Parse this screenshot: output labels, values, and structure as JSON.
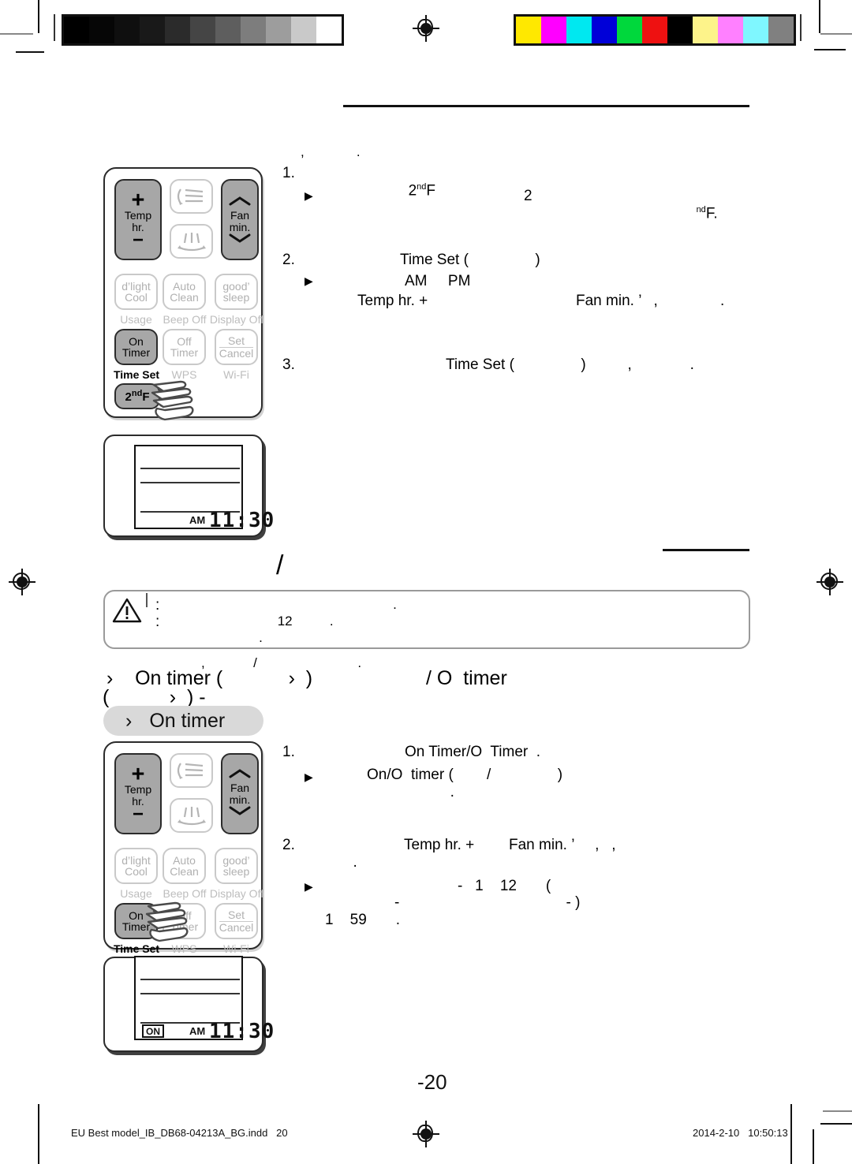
{
  "page": {
    "number": "-20",
    "footer_file": "EU Best model_IB_DB68-04213A_BG.indd   20",
    "footer_timestamp": "2014-2-10   10:50:13"
  },
  "printmarks": {
    "grayscale_steps": [
      "#000000",
      "#070707",
      "#101010",
      "#1a1a1a",
      "#2b2b2b",
      "#454545",
      "#5e5e5e",
      "#7d7d7d",
      "#9d9d9d",
      "#c6c6c6",
      "#ffffff"
    ],
    "color_steps": [
      "#ffe800",
      "#ff00ff",
      "#00e8f0",
      "#0000d8",
      "#00d83c",
      "#ee1111",
      "#000000",
      "#fff municipal",
      "#ff80ff",
      "#7ff7ff",
      "#808080"
    ],
    "color_steps_fixed": [
      "#ffe800",
      "#ff00ff",
      "#00e8f0",
      "#0000d8",
      "#00d83c",
      "#ee1111",
      "#000000",
      "#fdf38a",
      "#ff80ff",
      "#7ff7ff",
      "#808080"
    ]
  },
  "remote": {
    "temp_plus": "+",
    "temp_label_1": "Temp",
    "temp_label_2": "hr.",
    "temp_minus": "−",
    "fan_up": "⌃",
    "fan_label_1": "Fan",
    "fan_label_2": "min.",
    "fan_down": "⌄",
    "dlight_1": "d’light",
    "dlight_2": "Cool",
    "usage": "Usage",
    "auto_1": "Auto",
    "auto_2": "Clean",
    "beep_off": "Beep Off",
    "good_1": "good’",
    "good_2": "sleep",
    "display_off": "Display Off",
    "on_timer_1": "On",
    "on_timer_2": "Timer",
    "time_set": "Time Set",
    "off_timer_1": "Off",
    "off_timer_2": "Timer",
    "wps": "WPS",
    "set": "Set",
    "cancel": "Cancel",
    "wifi": "Wi-Fi",
    "secondf": "2",
    "secondf_sup": "nd",
    "secondf_tail": "F"
  },
  "lcd_top": {
    "ampm": "AM",
    "time": "11:30"
  },
  "lcd_bottom": {
    "on_badge": "ON",
    "ampm": "AM",
    "time": "11:30"
  },
  "section_top": {
    "intro_fragment": ",              .",
    "step1_num": "1.",
    "step1_text": "2",
    "step1_sup": "nd",
    "step1_tail": "F",
    "step1_bullet": "▶",
    "step1_bullet_mid": "2",
    "step1_bullet_sup": "nd",
    "step1_bullet_tail": "F.",
    "step2_num": "2.",
    "step2_text": "Time Set (                )",
    "step2_bullet": "▶",
    "step2_bullet_text": "AM     PM",
    "step2_line3_left": "Temp hr. +",
    "step2_line3_right": "Fan min. ’   ,               .",
    "step3_num": "3.",
    "step3_text": "Time Set (                )          ,              ."
  },
  "warning": {
    "icon": "warning-triangle",
    "bullet1": ":",
    "bullet1_text": "                                                             .",
    "bullet2": ":",
    "bullet2_text": "                              12          .",
    "line3": "                         ."
  },
  "section_mid": {
    "line_a": ",             /                           .",
    "line_b_left": "›    On timer (            ›  )",
    "line_b_right": "/ O  timer",
    "line_c": "(           ›  ) -",
    "chip_arrow": "›",
    "chip_label": "On timer"
  },
  "section_bottom": {
    "step1_num": "1.",
    "step1_text": "On Timer/O  Timer  .",
    "step1_bullet": "▶",
    "step1_bullet_text": "On/O  timer (        /                )",
    "step1_line3": "                    .",
    "step2_num": "2.",
    "step2_left": "Temp hr. +",
    "step2_right": "Fan min. ’     ,   ,",
    "step2_line2": "         .",
    "step2_bullet": "▶",
    "step2_bullet_text": "-   1    12       (",
    "step2_bullet_line2": "-                                        - )",
    "step2_bullet_line3": "1    59       ."
  }
}
